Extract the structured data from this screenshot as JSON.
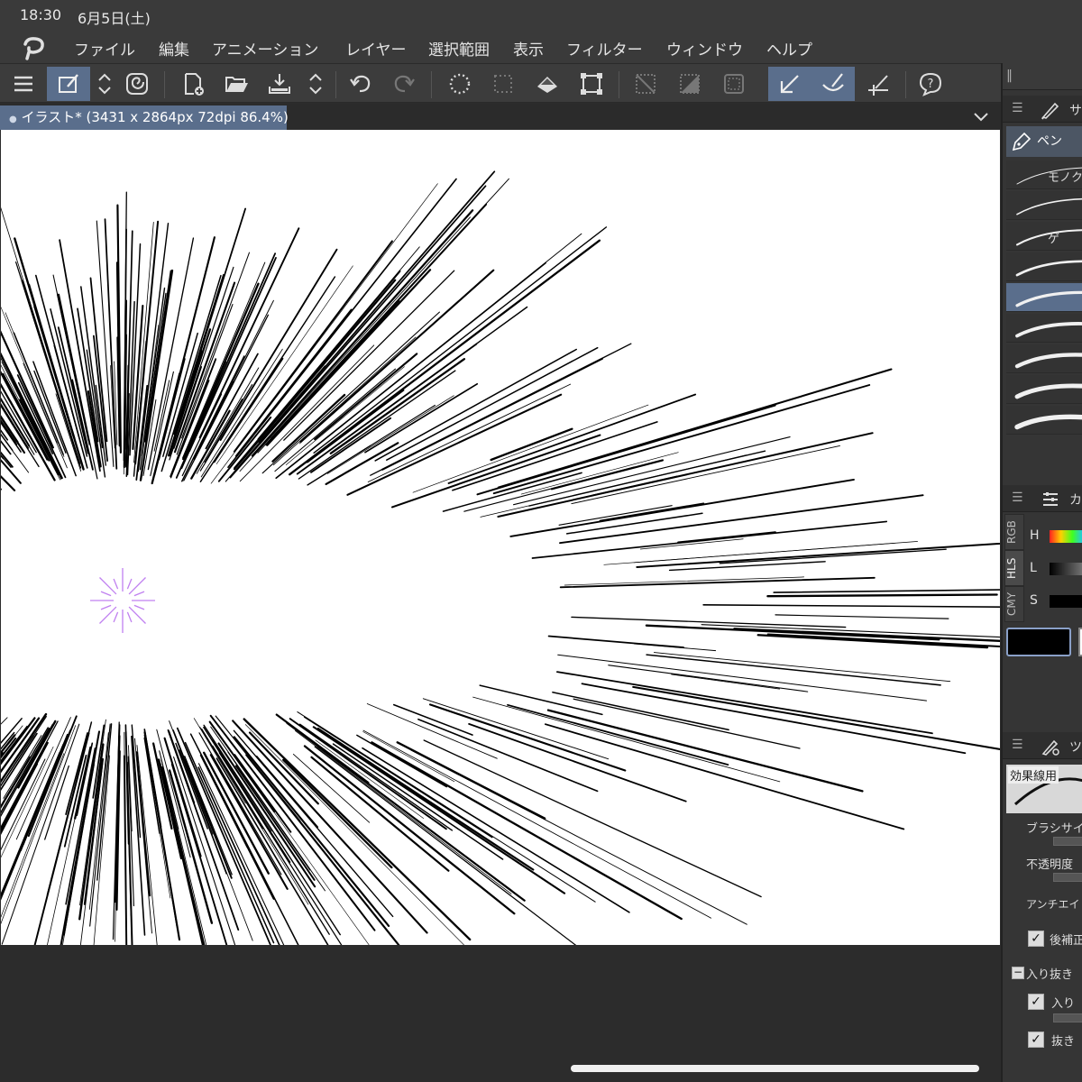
{
  "status": {
    "time": "18:30",
    "date": "6月5日(土)"
  },
  "menu": {
    "items": [
      "ファイル",
      "編集",
      "アニメーション",
      "レイヤー",
      "選択範囲",
      "表示",
      "フィルター",
      "ウィンドウ",
      "ヘルプ"
    ]
  },
  "toolbar": {
    "buttons": [
      "menu-icon",
      "edit-mode-icon",
      "up-down-icon",
      "spiral-icon",
      "new-file-icon",
      "open-folder-icon",
      "save-icon",
      "up-down-icon",
      "undo-icon",
      "redo-icon",
      "dotted-circle-icon",
      "selection-dots-icon",
      "fill-icon",
      "transform-icon",
      "deselect-icon",
      "invert-selection-icon",
      "selection-border-icon",
      "pen-snap-icon",
      "brush-snap-icon",
      "ruler-icon",
      "help-icon"
    ]
  },
  "document": {
    "tab_title": "イラスト* (3431 x 2864px 72dpi 86.4%)"
  },
  "subtool_panel": {
    "header": "サ",
    "group_label": "ペン",
    "brushes": [
      "モノク",
      "",
      "ゲ",
      "",
      "",
      "",
      "",
      "",
      ""
    ]
  },
  "color_panel": {
    "header": "カ",
    "tabs": [
      "RGB",
      "HLS",
      "CMY"
    ],
    "sliders": [
      "H",
      "L",
      "S"
    ]
  },
  "tool_property": {
    "header": "ツ",
    "preset_name": "効果線用",
    "brush_size_label": "ブラシサイ",
    "opacity_label": "不透明度",
    "antialias_label": "アンチエイリ",
    "stabilization_label": "後補正",
    "taper_label": "入り抜き",
    "taper_in_label": "入り",
    "taper_out_label": "抜き"
  },
  "colors": {
    "accent": "#5a6e8c",
    "chrome": "#3a3a3a",
    "canvas": "#ffffff",
    "focus_marker": "#c080f0"
  }
}
